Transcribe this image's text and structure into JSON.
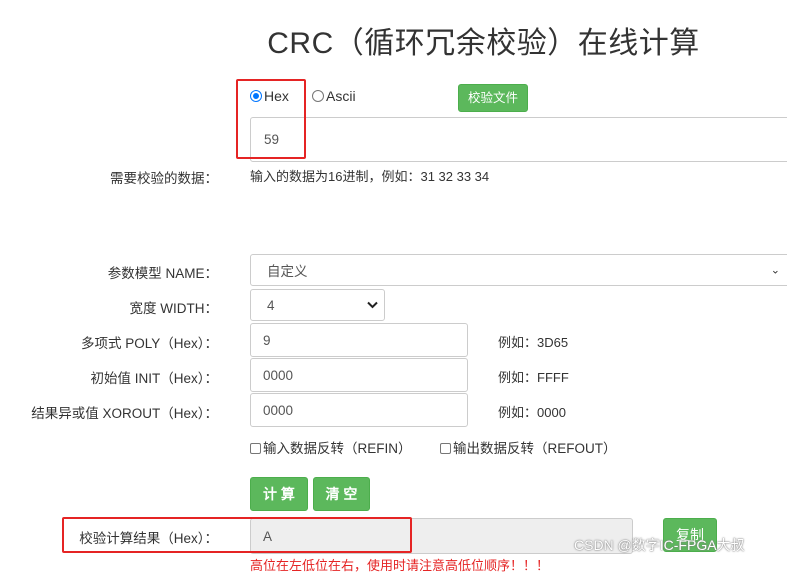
{
  "title": "CRC（循环冗余校验）在线计算",
  "input_mode": {
    "hex_label": "Hex",
    "ascii_label": "Ascii",
    "selected": "Hex"
  },
  "check_file_button": "校验文件",
  "data_input": {
    "label": "需要校验的数据：",
    "value": "59",
    "hint": "输入的数据为16进制，例如：31 32 33 34"
  },
  "params": {
    "model": {
      "label": "参数模型 NAME：",
      "value": "自定义"
    },
    "width": {
      "label": "宽度 WIDTH：",
      "value": "4"
    },
    "poly": {
      "label": "多项式 POLY（Hex）：",
      "value": "9",
      "example": "例如：3D65"
    },
    "init": {
      "label": "初始值 INIT（Hex）：",
      "value": "0000",
      "example": "例如：FFFF"
    },
    "xorout": {
      "label": "结果异或值 XOROUT（Hex）：",
      "value": "0000",
      "example": "例如：0000"
    },
    "refin_label": "输入数据反转（REFIN）",
    "refout_label": "输出数据反转（REFOUT）"
  },
  "buttons": {
    "calculate": "计 算",
    "clear": "清 空",
    "copy": "复制"
  },
  "result": {
    "label": "校验计算结果（Hex）：",
    "value": "A"
  },
  "footnote": "高位在左低位在右，使用时请注意高低位顺序！！！",
  "watermark": "CSDN @数字IC-FPGA大叔",
  "colors": {
    "accent_green": "#5cb85c",
    "highlight_red": "#e52424",
    "radio_blue": "#0075ff"
  }
}
